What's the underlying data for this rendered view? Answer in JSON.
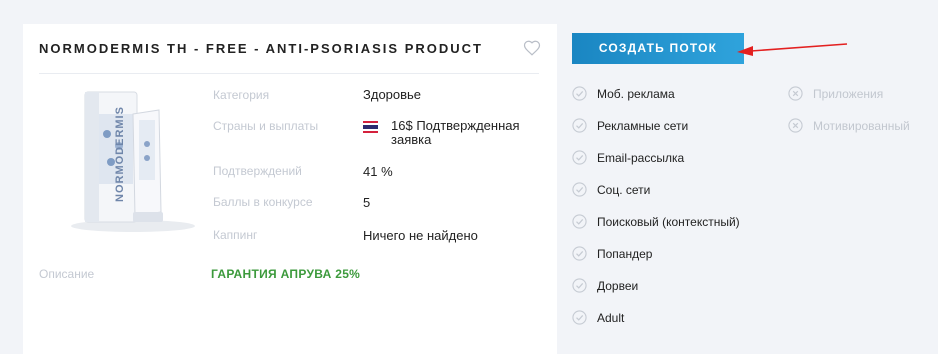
{
  "offer": {
    "title": "NORMODERMIS TH - FREE - ANTI-PSORIASIS PRODUCT",
    "product_image_brand": "NORMODERMIS"
  },
  "details": {
    "category_label": "Категория",
    "category_value": "Здоровье",
    "countries_label": "Страны и выплаты",
    "payout_amount": "16$",
    "payout_status": "Подтвержденная заявка",
    "approved_label": "Подтверждений",
    "approved_value": "41 %",
    "points_label": "Баллы в конкурсе",
    "points_value": "5",
    "capping_label": "Каппинг",
    "capping_value": "Ничего не найдено",
    "description_label": "Описание",
    "description_value": "ГАРАНТИЯ АПРУВА 25%"
  },
  "actions": {
    "create_stream_label": "СОЗДАТЬ ПОТОК"
  },
  "traffic_allowed": [
    "Моб. реклама",
    "Рекламные сети",
    "Email-рассылка",
    "Соц. сети",
    "Поисковый (контекстный)",
    "Попандер",
    "Дорвеи",
    "Adult"
  ],
  "traffic_forbidden": [
    "Приложения",
    "Мотивированный"
  ],
  "colors": {
    "accent": "#1a86c2",
    "description_green": "#3c9a3c",
    "arrow_red": "#e32020"
  }
}
